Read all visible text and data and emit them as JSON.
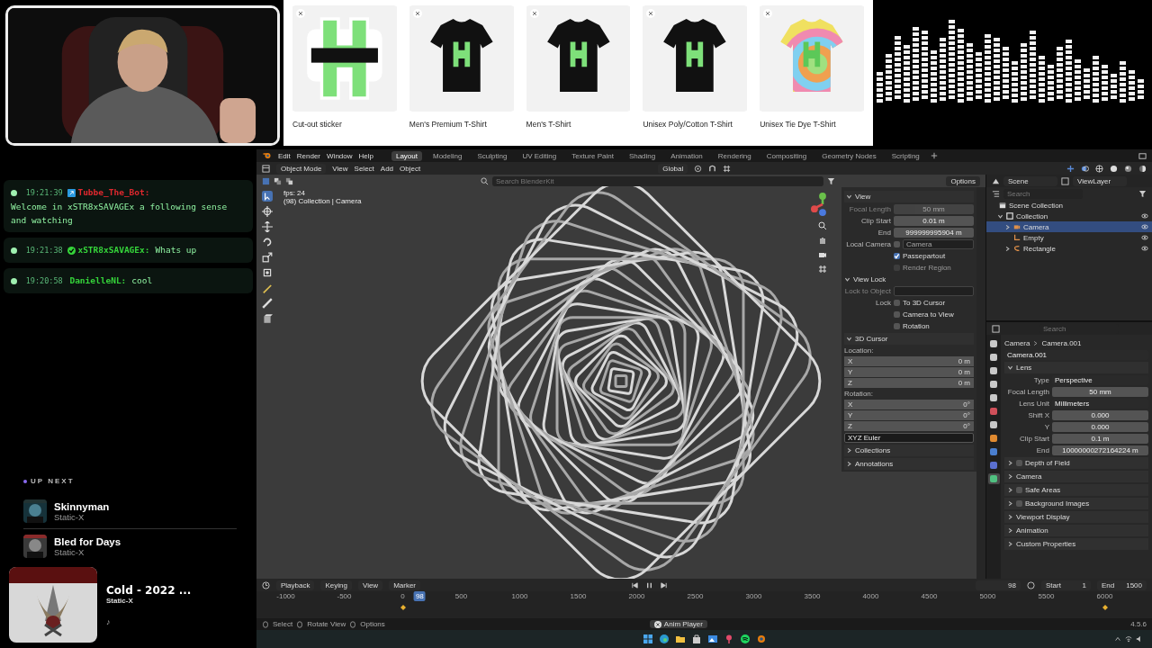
{
  "store": {
    "products": [
      {
        "name": "Cut-out sticker",
        "kind": "sticker"
      },
      {
        "name": "Men's Premium T-Shirt",
        "kind": "black_shirt"
      },
      {
        "name": "Men's T-Shirt",
        "kind": "black_shirt"
      },
      {
        "name": "Unisex Poly/Cotton T-Shirt",
        "kind": "black_shirt"
      },
      {
        "name": "Unisex Tie Dye T-Shirt",
        "kind": "tie_dye"
      }
    ]
  },
  "chat": {
    "messages": [
      {
        "time": "19:21:39",
        "kind": "bot",
        "user": "Tubbe_The_Bot:",
        "color": "#e0282e",
        "text": "Welcome in xSTR8xSAVAGEx a following sense and watching"
      },
      {
        "time": "19:21:38",
        "kind": "verified",
        "user": "xSTR8xSAVAGEx:",
        "color": "#35d43a",
        "text": "Whats up"
      },
      {
        "time": "19:20:58",
        "kind": "plain",
        "user": "DanielleNL:",
        "color": "#35d43a",
        "text": "cool"
      }
    ]
  },
  "up_next": {
    "label": "UP NEXT",
    "tracks": [
      {
        "title": "Skinnyman",
        "artist": "Static-X"
      },
      {
        "title": "Bled for Days",
        "artist": "Static-X"
      }
    ]
  },
  "now_playing": {
    "title": "Cold - 2022 ...",
    "artist": "Static-X",
    "note": "♪"
  },
  "blender": {
    "menus": [
      "Edit",
      "Render",
      "Window",
      "Help"
    ],
    "workspaces": [
      {
        "label": "Layout",
        "selected": true
      },
      {
        "label": "Modeling",
        "selected": false
      },
      {
        "label": "Sculpting",
        "selected": false
      },
      {
        "label": "UV Editing",
        "selected": false
      },
      {
        "label": "Texture Paint",
        "selected": false
      },
      {
        "label": "Shading",
        "selected": false
      },
      {
        "label": "Animation",
        "selected": false
      },
      {
        "label": "Rendering",
        "selected": false
      },
      {
        "label": "Compositing",
        "selected": false
      },
      {
        "label": "Geometry Nodes",
        "selected": false
      },
      {
        "label": "Scripting",
        "selected": false
      }
    ],
    "header": {
      "mode": "Object Mode",
      "menus": [
        "View",
        "Select",
        "Add",
        "Object"
      ],
      "orientation": "Global"
    },
    "viewport": {
      "search_placeholder": "Search BlenderKit",
      "options": "Options",
      "fps": "fps: 24",
      "context": "(98) Collection | Camera"
    },
    "n_panel": {
      "sections": [
        {
          "title": "View",
          "expanded": true,
          "rows": [
            {
              "kind": "field",
              "label": "Focal Length",
              "value": "50 mm",
              "disabled": true
            },
            {
              "kind": "field",
              "label": "Clip Start",
              "value": "0.01 m",
              "disabled": false
            },
            {
              "kind": "field",
              "label": "End",
              "value": "999999995904 m",
              "disabled": false
            },
            {
              "kind": "check_field",
              "label": "Local Camera",
              "checked": false,
              "value": "Camera",
              "disabled": true
            },
            {
              "kind": "check",
              "text": "Passepartout",
              "checked": true,
              "disabled": false
            },
            {
              "kind": "check",
              "text": "Render Region",
              "checked": false,
              "disabled": true
            },
            {
              "kind": "subsection",
              "title": "View Lock",
              "expanded": true
            },
            {
              "kind": "object_field",
              "label": "Lock to Object",
              "disabled": true
            },
            {
              "kind": "check",
              "label": "Lock",
              "text": "To 3D Cursor",
              "checked": false,
              "disabled": false
            },
            {
              "kind": "check",
              "text": "Camera to View",
              "checked": false,
              "disabled": false
            },
            {
              "kind": "check",
              "text": "Rotation",
              "checked": false,
              "disabled": false
            }
          ]
        },
        {
          "title": "3D Cursor",
          "expanded": true,
          "rows": [
            {
              "kind": "caption",
              "text": "Location:"
            },
            {
              "kind": "axis",
              "label": "X",
              "value": "0 m"
            },
            {
              "kind": "axis",
              "label": "Y",
              "value": "0 m"
            },
            {
              "kind": "axis",
              "label": "Z",
              "value": "0 m"
            },
            {
              "kind": "caption",
              "text": "Rotation:"
            },
            {
              "kind": "axis",
              "label": "X",
              "value": "0°"
            },
            {
              "kind": "axis",
              "label": "Y",
              "value": "0°"
            },
            {
              "kind": "axis",
              "label": "Z",
              "value": "0°"
            },
            {
              "kind": "select",
              "value": "XYZ Euler"
            }
          ]
        },
        {
          "title": "Collections",
          "expanded": false
        },
        {
          "title": "Annotations",
          "expanded": false
        }
      ]
    },
    "outliner": {
      "scene": "Scene",
      "view_layer": "ViewLayer",
      "search_placeholder": "Search",
      "tree": [
        {
          "label": "Scene Collection",
          "kind": "scene",
          "selected": false,
          "children": [
            {
              "label": "Collection",
              "kind": "collection",
              "selected": false,
              "expanded": true,
              "children": [
                {
                  "label": "Camera",
                  "kind": "camera",
                  "selected": true,
                  "expanded": false
                },
                {
                  "label": "Empty",
                  "kind": "empty",
                  "selected": false
                },
                {
                  "label": "Rectangle",
                  "kind": "curve",
                  "selected": false,
                  "expanded": false
                }
              ]
            }
          ]
        }
      ]
    },
    "properties": {
      "search_placeholder": "Search",
      "tabs": [
        {
          "color": "#c8c8c8",
          "selected": false
        },
        {
          "color": "#c8c8c8",
          "selected": false
        },
        {
          "color": "#c8c8c8",
          "selected": false
        },
        {
          "color": "#c8c8c8",
          "selected": false
        },
        {
          "color": "#c8c8c8",
          "selected": false
        },
        {
          "color": "#d0505a",
          "selected": false
        },
        {
          "color": "#c8c8c8",
          "selected": false
        },
        {
          "color": "#e08a30",
          "selected": false
        },
        {
          "color": "#4a7fd0",
          "selected": false
        },
        {
          "color": "#5a6fd0",
          "selected": false
        },
        {
          "color": "#50c080",
          "selected": true
        }
      ],
      "breadcrumb": [
        "Camera",
        "Camera.001"
      ],
      "datablock": "Camera.001",
      "sections": [
        {
          "title": "Lens",
          "kind": "plain",
          "expanded": true,
          "rows": [
            {
              "kind": "select",
              "label": "Type",
              "value": "Perspective"
            },
            {
              "kind": "number",
              "label": "Focal Length",
              "value": "50 mm"
            },
            {
              "kind": "select",
              "label": "Lens Unit",
              "value": "Millimeters"
            },
            {
              "kind": "number",
              "label": "Shift X",
              "value": "0.000"
            },
            {
              "kind": "number",
              "label": "Y",
              "value": "0.000"
            },
            {
              "kind": "number",
              "label": "Clip Start",
              "value": "0.1 m"
            },
            {
              "kind": "number",
              "label": "End",
              "value": "10000000272164224 m"
            }
          ]
        },
        {
          "title": "Depth of Field",
          "kind": "toggle",
          "checked": false,
          "expanded": false
        },
        {
          "title": "Camera",
          "kind": "plain",
          "expanded": false
        },
        {
          "title": "Safe Areas",
          "kind": "toggle",
          "checked": false,
          "expanded": false
        },
        {
          "title": "Background Images",
          "kind": "toggle",
          "checked": false,
          "expanded": false
        },
        {
          "title": "Viewport Display",
          "kind": "plain",
          "expanded": false
        },
        {
          "title": "Animation",
          "kind": "plain",
          "expanded": false
        },
        {
          "title": "Custom Properties",
          "kind": "plain",
          "expanded": false
        }
      ]
    },
    "timeline": {
      "menus": [
        "Playback",
        "Keying",
        "View",
        "Marker"
      ],
      "frame": "98",
      "start_label": "Start",
      "start": "1",
      "end_label": "End",
      "end": "1500",
      "playhead": "98",
      "ticks": [
        "-1000",
        "-500",
        "0",
        "500",
        "1000",
        "1500",
        "2000",
        "2500",
        "3000",
        "3500",
        "4000",
        "4500",
        "5000",
        "5500",
        "6000"
      ]
    },
    "status": {
      "hints": [
        "Select",
        "Rotate View",
        "Options"
      ],
      "notice": "Anim Player",
      "version": "4.5.6"
    }
  }
}
